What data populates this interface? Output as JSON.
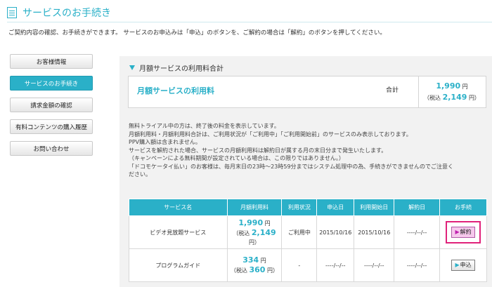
{
  "header": {
    "title": "サービスのお手続き"
  },
  "intro": "ご契約内容の確認、お手続きができます。 サービスのお申込みは「申込」のボタンを、ご解約の場合は「解約」のボタンを押してください。",
  "sidebar": {
    "items": [
      {
        "label": "お客様情報"
      },
      {
        "label": "サービスのお手続き"
      },
      {
        "label": "請求金額の確認"
      },
      {
        "label": "有料コンテンツの購入履歴"
      },
      {
        "label": "お問い合わせ"
      }
    ]
  },
  "section_title": "月額サービスの利用料合計",
  "summary": {
    "label": "月額サービスの利用料",
    "total_label": "合計",
    "amount": "1,990",
    "yen": "円",
    "tax_prefix": "（税込",
    "tax_amount": "2,149",
    "tax_suffix": "円）"
  },
  "notes": [
    "無料トライアル中の方は、終了後の料金を表示しています。",
    "月額利用料・月額利用料合計は、ご利用状況が「ご利用中」「ご利用開始前」のサービスのみ表示しております。",
    "PPV購入額は含まれません。",
    "サービスを解約された場合、サービスの月額利用料は解約日が属する月の末日分まで発生いたします。",
    "（キャンペーンによる無料期間が設定されている場合は、この限りではありません。）",
    "「ドコモケータイ払い」のお客様は、毎月末日の23時〜23時59分まではシステム処理中の為、手続きができませんのでご注意く",
    "ださい。"
  ],
  "table": {
    "headers": [
      "サービス名",
      "月額利用料",
      "利用状況",
      "申込日",
      "利用開始日",
      "解約日",
      "お手続"
    ],
    "rows": [
      {
        "name": "ビデオ見放題サービス",
        "fee": "1,990",
        "fee_unit": "円",
        "tax_prefix": "（税込",
        "tax": "2,149",
        "tax_suffix": "円）",
        "status": "ご利用中",
        "applied": "2015/10/16",
        "start": "2015/10/16",
        "cancel": "----/--/--",
        "action": "解約"
      },
      {
        "name": "プログラムガイド",
        "fee": "334",
        "fee_unit": "円",
        "tax_prefix": "（税込",
        "tax": "360",
        "tax_suffix": "円）",
        "status": "-",
        "applied": "----/--/--",
        "start": "----/--/--",
        "cancel": "----/--/--",
        "action": "申込"
      }
    ]
  },
  "colors": {
    "accent": "#2ab0c8",
    "highlight": "#e0227a",
    "cancel_button": "#f6c8ec"
  }
}
